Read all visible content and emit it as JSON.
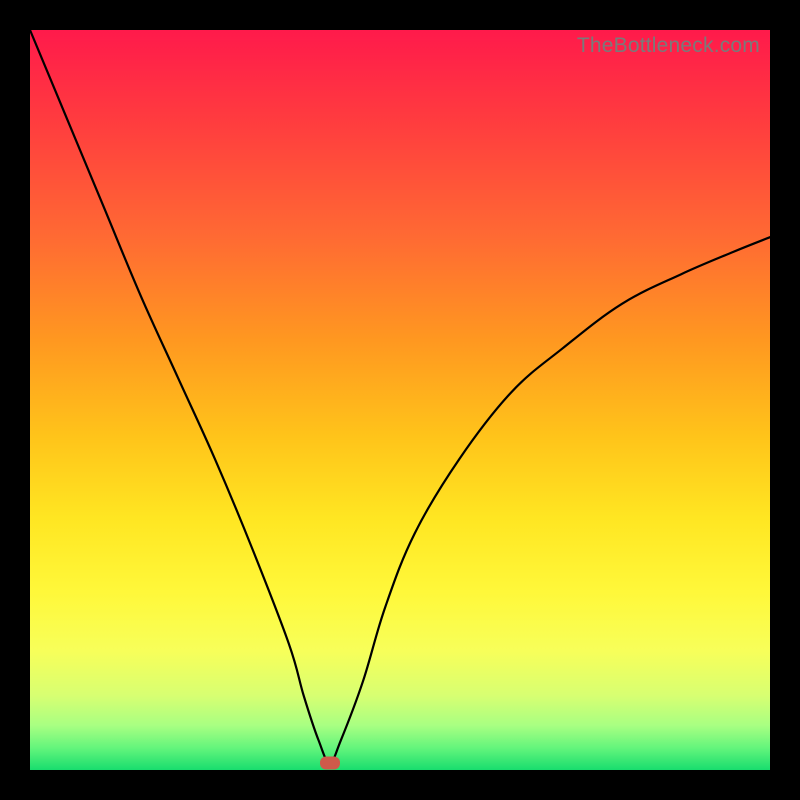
{
  "watermark": {
    "text": "TheBottleneck.com"
  },
  "colors": {
    "frame": "#000000",
    "curve": "#000000",
    "marker": "#cf5a4a",
    "gradient_stops": [
      "#ff1a4b",
      "#ff3b3f",
      "#ff6a33",
      "#ff9820",
      "#ffc41a",
      "#ffe622",
      "#fff83a",
      "#f7ff5a",
      "#d7ff72",
      "#a8ff82",
      "#64f57c",
      "#18dd6e"
    ]
  },
  "chart_data": {
    "type": "line",
    "title": "",
    "xlabel": "",
    "ylabel": "",
    "xlim": [
      0,
      100
    ],
    "ylim": [
      0,
      100
    ],
    "series": [
      {
        "name": "bottleneck-curve",
        "x": [
          0,
          5,
          10,
          15,
          20,
          25,
          30,
          35,
          37,
          39,
          40.5,
          42,
          45,
          48,
          52,
          58,
          65,
          72,
          80,
          88,
          95,
          100
        ],
        "values": [
          100,
          88,
          76,
          64,
          53,
          42,
          30,
          17,
          10,
          4,
          1,
          4,
          12,
          22,
          32,
          42,
          51,
          57,
          63,
          67,
          70,
          72
        ]
      }
    ],
    "annotations": [
      {
        "name": "optimal-marker",
        "x": 40.5,
        "y": 1
      }
    ]
  }
}
